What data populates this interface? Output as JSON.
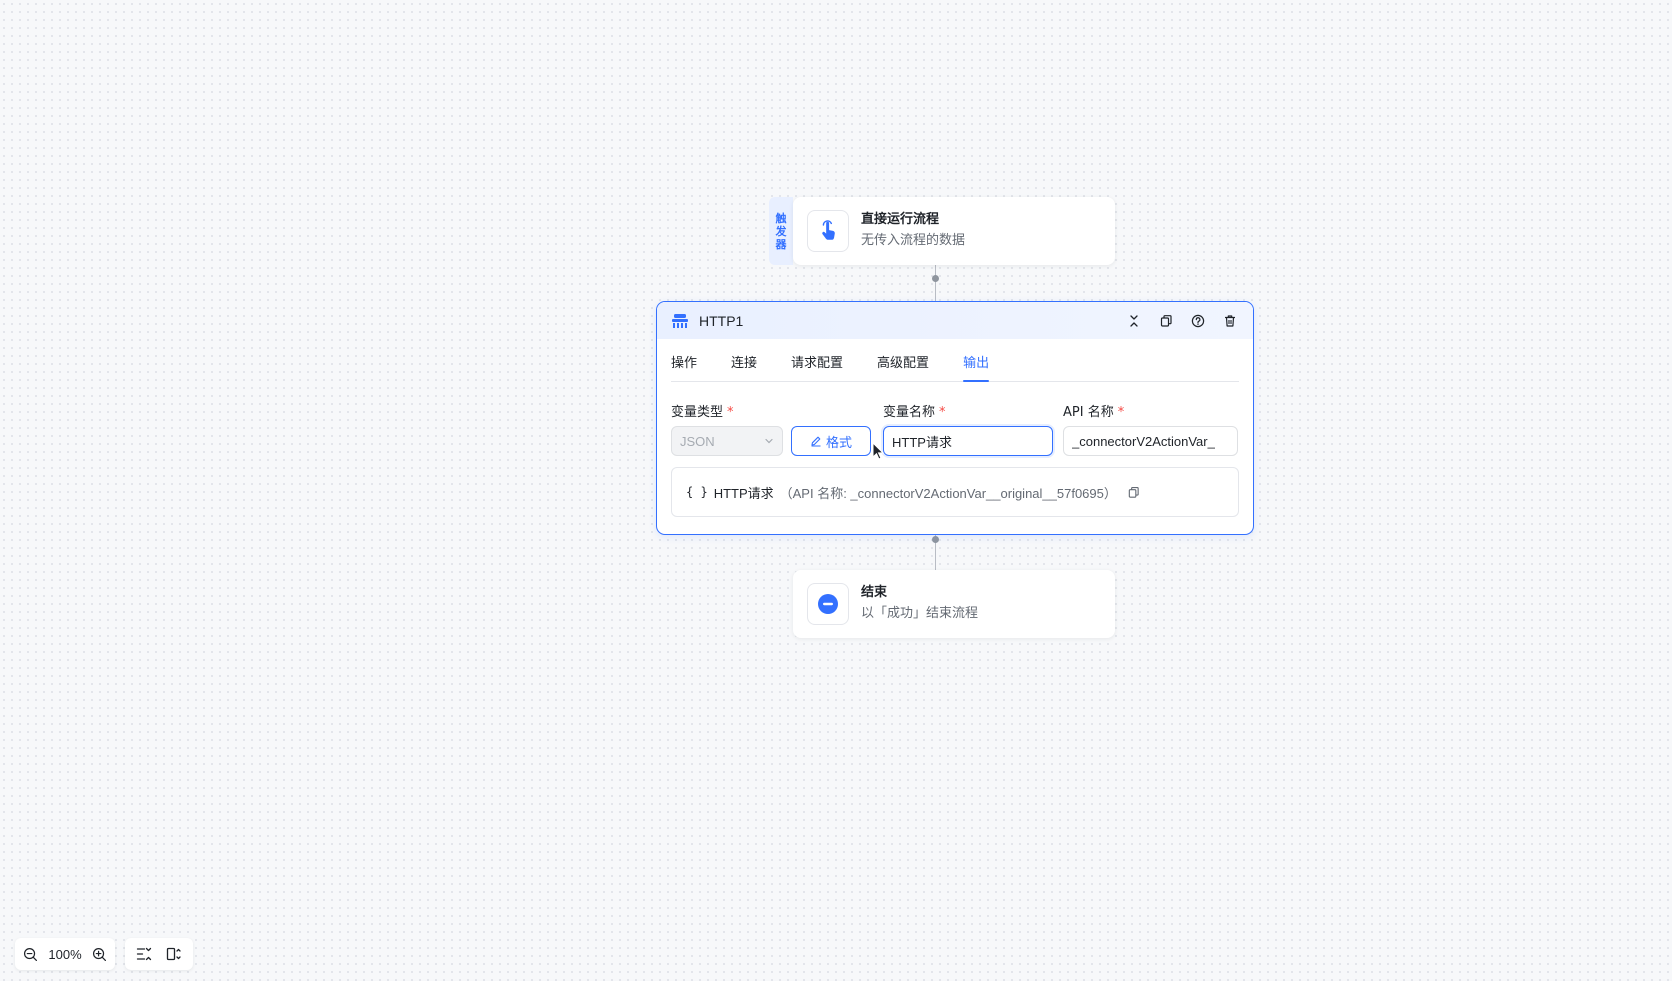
{
  "colors": {
    "accent": "#3370ff",
    "required": "#f54a45",
    "text": "#1f2329",
    "muted": "#646a73"
  },
  "trigger_node": {
    "tag_chars": [
      "触",
      "发",
      "器"
    ],
    "icon": "tap-hand-icon",
    "title": "直接运行流程",
    "subtitle": "无传入流程的数据"
  },
  "http_node": {
    "icon": "http-connector-icon",
    "title": "HTTP1",
    "header_actions": [
      "collapse-icon",
      "copy-icon",
      "help-icon",
      "delete-icon"
    ],
    "tabs": [
      {
        "label": "操作",
        "active": false
      },
      {
        "label": "连接",
        "active": false
      },
      {
        "label": "请求配置",
        "active": false
      },
      {
        "label": "高级配置",
        "active": false
      },
      {
        "label": "输出",
        "active": true
      }
    ],
    "fields": {
      "var_type_label": "变量类型",
      "var_name_label": "变量名称",
      "api_name_label": "API 名称",
      "required_mark": "*",
      "var_type_value": "JSON",
      "format_button": "格式",
      "var_name_value": "HTTP请求",
      "api_name_value": "_connectorV2ActionVar_"
    },
    "preview": {
      "brace": "{ }",
      "name": "HTTP请求",
      "api_text": "（API 名称: _connectorV2ActionVar__original__57f0695）"
    }
  },
  "end_node": {
    "icon": "minus-circle-icon",
    "title": "结束",
    "subtitle": "以「成功」结束流程"
  },
  "zoom": {
    "level": "100%"
  }
}
